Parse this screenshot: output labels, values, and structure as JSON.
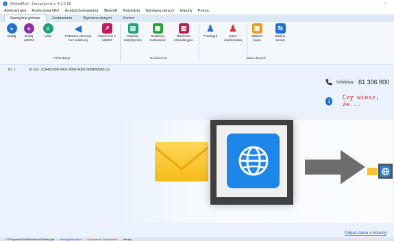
{
  "window": {
    "title": "GlobalMed - Zarządzenie v. 4.2.6.68"
  },
  "menu": [
    "Administrator",
    "Rozliczenia NFZ",
    "Analizy/Zestawienia",
    "Słowniki",
    "Narzędzia",
    "Wymiana danych",
    "Importy",
    "Pomoc"
  ],
  "tabs": [
    {
      "label": "Narzędzia główne"
    },
    {
      "label": "Zestawienia"
    },
    {
      "label": "Wymiana danych"
    },
    {
      "label": "Pomoc"
    }
  ],
  "ribbon": {
    "buttons": [
      {
        "label": "Dodaj",
        "color": "#1f6fd1",
        "icon": "plus-icon"
      },
      {
        "label": "Dodaj eZWM",
        "color": "#8e2ea8",
        "icon": "plus-icon"
      },
      {
        "label": "Lista",
        "color": "#22a07a",
        "icon": "list-icon"
      },
      {
        "label": "Pobranie zlecenia bez realizacji",
        "color": "#1f6fd1",
        "icon": "back-arrow-icon"
      },
      {
        "label": "Import csv z eZWM",
        "color": "#c2185b",
        "icon": "import-icon"
      },
      {
        "label": "Raporty statystyczne",
        "color": "#22a07a",
        "icon": "report-icon"
      },
      {
        "label": "Szablony rachunków",
        "color": "#2e9e3b",
        "icon": "template-icon"
      },
      {
        "label": "Rachunki refundacyjne",
        "color": "#b0204b",
        "icon": "invoice-icon"
      },
      {
        "label": "Przeloguj",
        "color": "#1f6fd1",
        "icon": "user-icon"
      },
      {
        "label": "Dane użytkownika",
        "color": "#d8302e",
        "icon": "user-data-icon"
      },
      {
        "label": "Odtwórz kopię",
        "color": "#e0a020",
        "icon": "restore-icon"
      },
      {
        "label": "Zdalny serwis",
        "color": "#1f6fd1",
        "icon": "remote-icon"
      }
    ],
    "groups": {
      "refundacja": "Refundacja",
      "rozliczenia": "Rozliczenia",
      "baza_danych": "Baza danych"
    }
  },
  "main": {
    "id_label": "ID: 2",
    "id_inst": "ID inst.: {CF45300B-0432-4368-4060-56B4B06A512}",
    "infolinia_label": "Infolinia:",
    "infolinia_number": "61 306 800",
    "czy_wiesz": "Czy wiesz, że...",
    "licencji_link": "Pokaż dane o licencji"
  },
  "status": {
    "path": "C:\\Program\\GlobalMed\\baza\\Global.gdb",
    "site": "www.globalmed.pl",
    "user_label": "Użytkownik: Superadmin",
    "extra": "Wersja"
  }
}
